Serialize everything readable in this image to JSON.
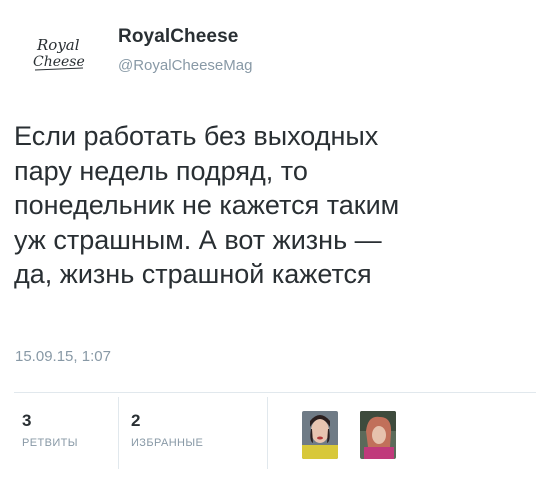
{
  "author": {
    "name": "RoyalCheese",
    "handle": "@RoyalCheeseMag",
    "logo_text_1": "Royal",
    "logo_text_2": "Cheese"
  },
  "tweet": {
    "text": "Если работать без выходных\nпару недель подряд, то\nпонедельник не кажется таким\nуж страшным. А вот жизнь —\nда, жизнь страшной кажется",
    "timestamp": "15.09.15, 1:07"
  },
  "stats": {
    "retweets_count": "3",
    "retweets_label": "РЕТВИТЫ",
    "favorites_count": "2",
    "favorites_label": "ИЗБРАННЫЕ"
  },
  "favorited_by": [
    {
      "icon": "user-avatar-1"
    },
    {
      "icon": "user-avatar-2"
    }
  ]
}
